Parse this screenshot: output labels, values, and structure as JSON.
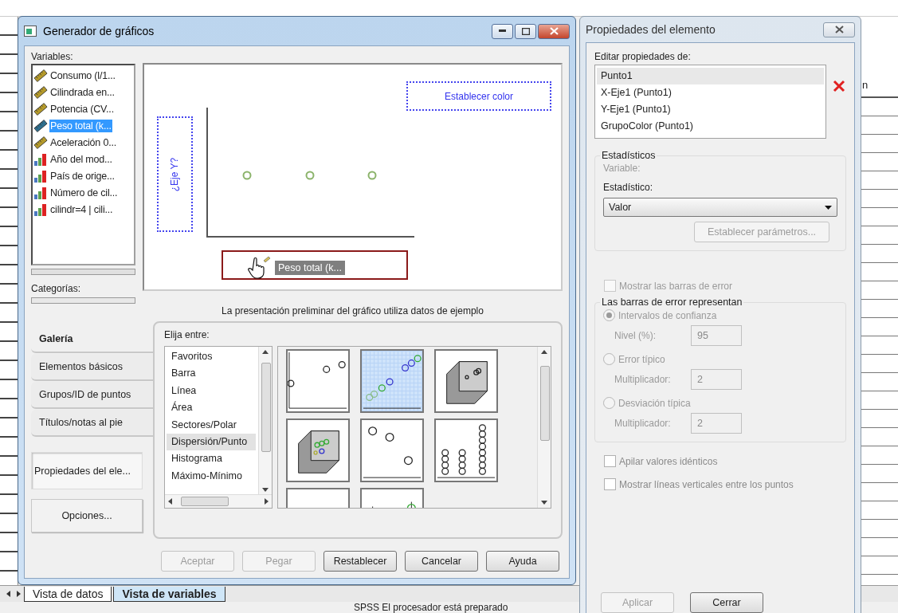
{
  "background_app": {
    "column_header": "n",
    "tabs": [
      {
        "label": "Vista de datos",
        "selected": false
      },
      {
        "label": "Vista de variables",
        "selected": true
      }
    ],
    "status": "SPSS El procesador está preparado"
  },
  "chart_builder": {
    "title": "Generador de gráficos",
    "variables_label": "Variables:",
    "variables": [
      {
        "label": "Consumo (l/1...",
        "kind": "scale",
        "selected": false
      },
      {
        "label": "Cilindrada en...",
        "kind": "scale",
        "selected": false
      },
      {
        "label": "Potencia (CV...",
        "kind": "scale",
        "selected": false
      },
      {
        "label": "Peso total (k...",
        "kind": "scale",
        "selected": true
      },
      {
        "label": "Aceleración 0...",
        "kind": "scale",
        "selected": false
      },
      {
        "label": "Año del mod...",
        "kind": "nominal",
        "selected": false
      },
      {
        "label": "País de orige...",
        "kind": "nominal",
        "selected": false
      },
      {
        "label": "Número de cil...",
        "kind": "nominal",
        "selected": false
      },
      {
        "label": "cilindr=4 | cili...",
        "kind": "nominal",
        "selected": false
      }
    ],
    "categories_label": "Categorías:",
    "preview": {
      "y_axis_zone": "¿Eje Y?",
      "color_zone": "Establecer color",
      "dragged_variable": "Peso total (k..."
    },
    "preview_caption": "La presentación preliminar del gráfico utiliza datos de ejemplo",
    "tabs": [
      {
        "label": "Galería",
        "selected": true
      },
      {
        "label": "Elementos básicos",
        "selected": false
      },
      {
        "label": "Grupos/ID de puntos",
        "selected": false
      },
      {
        "label": "Títulos/notas al pie",
        "selected": false
      }
    ],
    "side_buttons": [
      {
        "label": "Propiedades del ele...",
        "pressed": true
      },
      {
        "label": "Opciones...",
        "pressed": false
      }
    ],
    "choose_label": "Elija entre:",
    "chart_types": [
      {
        "label": "Favoritos",
        "selected": false
      },
      {
        "label": "Barra",
        "selected": false
      },
      {
        "label": "Línea",
        "selected": false
      },
      {
        "label": "Área",
        "selected": false
      },
      {
        "label": "Sectores/Polar",
        "selected": false
      },
      {
        "label": "Dispersión/Punto",
        "selected": true
      },
      {
        "label": "Histograma",
        "selected": false
      },
      {
        "label": "Máximo-Mínimo",
        "selected": false
      }
    ],
    "thumbnails": [
      {
        "kind": "scatter",
        "selected": false
      },
      {
        "kind": "grouped",
        "selected": true
      },
      {
        "kind": "cube",
        "selected": false
      },
      {
        "kind": "cube-grouped",
        "selected": false
      },
      {
        "kind": "scatter-sparse",
        "selected": false
      },
      {
        "kind": "dot-stack",
        "selected": false
      },
      {
        "kind": "matrix",
        "selected": false
      },
      {
        "kind": "drop-line",
        "selected": false
      }
    ],
    "buttons": [
      {
        "label": "Aceptar",
        "disabled": true
      },
      {
        "label": "Pegar",
        "disabled": true
      },
      {
        "label": "Restablecer",
        "disabled": false
      },
      {
        "label": "Cancelar",
        "disabled": false
      },
      {
        "label": "Ayuda",
        "disabled": false
      }
    ]
  },
  "element_properties": {
    "title": "Propiedades del elemento",
    "edit_label": "Editar propiedades de:",
    "elements": [
      {
        "label": "Punto1",
        "selected": true
      },
      {
        "label": "X-Eje1 (Punto1)",
        "selected": false
      },
      {
        "label": "Y-Eje1 (Punto1)",
        "selected": false
      },
      {
        "label": "GrupoColor (Punto1)",
        "selected": false
      }
    ],
    "statistics": {
      "legend": "Estadísticos",
      "variable_label": "Variable:",
      "statistic_label": "Estadístico:",
      "statistic_value": "Valor",
      "params_button": "Establecer parámetros...",
      "params_disabled": true
    },
    "show_error_bars": {
      "label": "Mostrar las barras de error",
      "checked": false,
      "disabled": true
    },
    "error_bars": {
      "legend": "Las barras de error representan",
      "options": [
        {
          "label": "Intervalos de confianza",
          "selected": true,
          "field_label": "Nivel (%):",
          "field_value": "95"
        },
        {
          "label": "Error típico",
          "selected": false,
          "field_label": "Multiplicador:",
          "field_value": "2"
        },
        {
          "label": "Desviación típica",
          "selected": false,
          "field_label": "Multiplicador:",
          "field_value": "2"
        }
      ],
      "disabled": true
    },
    "checkboxes": [
      {
        "label": "Apilar valores idénticos",
        "checked": false,
        "disabled": false
      },
      {
        "label": "Mostrar líneas verticales entre los puntos",
        "checked": false,
        "disabled": false
      }
    ],
    "buttons": [
      {
        "label": "Aplicar",
        "disabled": true
      },
      {
        "label": "Cerrar",
        "disabled": false
      }
    ]
  }
}
